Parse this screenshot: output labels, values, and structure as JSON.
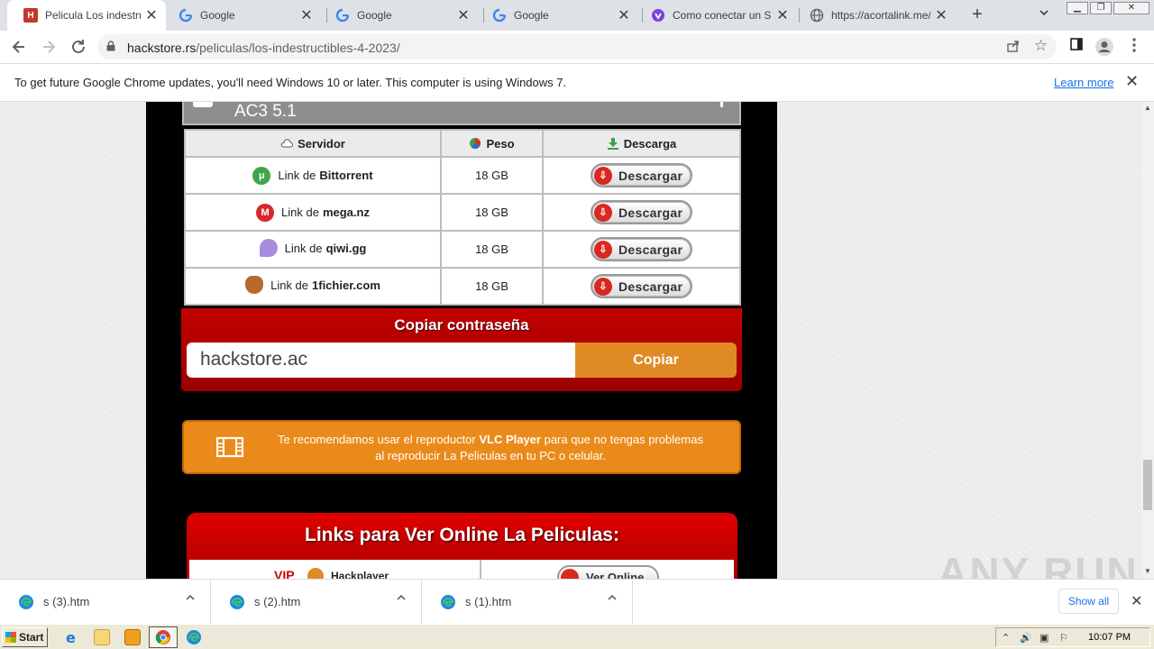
{
  "browser": {
    "tabs": [
      {
        "title": "Pelicula Los indestructib",
        "active": true,
        "icon": "hackstore-icon"
      },
      {
        "title": "Google",
        "active": false,
        "icon": "google-icon"
      },
      {
        "title": "Google",
        "active": false,
        "icon": "google-icon"
      },
      {
        "title": "Google",
        "active": false,
        "icon": "google-icon"
      },
      {
        "title": "Como conectar un Sma",
        "active": false,
        "icon": "purple-site-icon"
      },
      {
        "title": "https://acortalink.me/r",
        "active": false,
        "icon": "globe-icon"
      }
    ],
    "new_tab": "+",
    "url_domain": "hackstore.rs",
    "url_path": "/peliculas/los-indestructibles-4-2023/"
  },
  "infobar": {
    "message": "To get future Google Chrome updates, you'll need Windows 10 or later. This computer is using Windows 7.",
    "link": "Learn more"
  },
  "page": {
    "audio_label": "AC3 5.1",
    "table": {
      "headers": [
        "Servidor",
        "Peso",
        "Descarga"
      ],
      "rows": [
        {
          "prefix": "Link de",
          "server": "Bittorrent",
          "size": "18 GB",
          "button": "Descargar",
          "color": "#3fa54b"
        },
        {
          "prefix": "Link de",
          "server": "mega.nz",
          "size": "18 GB",
          "button": "Descargar",
          "color": "#d9272e"
        },
        {
          "prefix": "Link de",
          "server": "qiwi.gg",
          "size": "18 GB",
          "button": "Descargar",
          "color": "#a78bdc"
        },
        {
          "prefix": "Link de",
          "server": "1fichier.com",
          "size": "18 GB",
          "button": "Descargar",
          "color": "#b8692b"
        }
      ]
    },
    "password": {
      "title": "Copiar contraseña",
      "value": "hackstore.ac",
      "button": "Copiar"
    },
    "vlc": {
      "text_before": "Te recomendamos usar el reproductor ",
      "highlight": "VLC Player",
      "text_after": " para que no tengas problemas al reproducir La Peliculas en tu PC o celular."
    },
    "online": {
      "title": "Links para Ver Online La Peliculas:",
      "vip": "VIP",
      "player": "Hackplayer",
      "button": "Ver Online"
    },
    "watermark": "ANY RUN"
  },
  "downloads": {
    "items": [
      {
        "name": "s (3).htm"
      },
      {
        "name": "s (2).htm"
      },
      {
        "name": "s (1).htm"
      }
    ],
    "show_all": "Show all"
  },
  "taskbar": {
    "start": "Start",
    "clock": "10:07 PM"
  }
}
